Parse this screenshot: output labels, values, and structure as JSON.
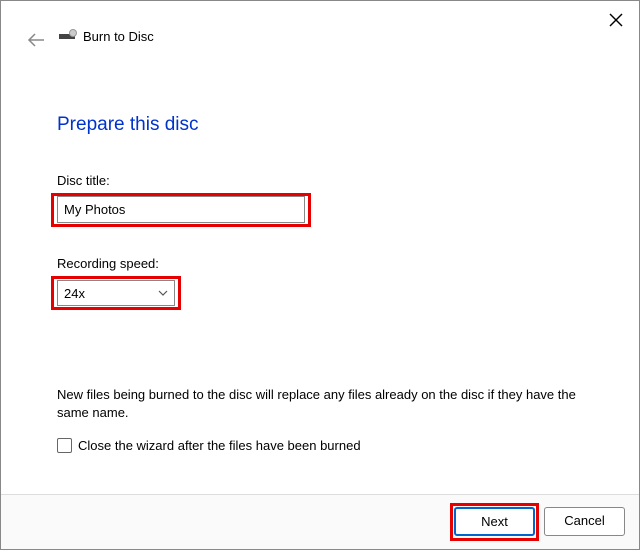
{
  "wizard": {
    "title": "Burn to Disc",
    "heading": "Prepare this disc"
  },
  "fields": {
    "disc_title_label": "Disc title:",
    "disc_title_value": "My Photos",
    "speed_label": "Recording speed:",
    "speed_value": "24x"
  },
  "note": "New files being burned to the disc will replace any files already on the disc if they have the same name.",
  "checkbox": {
    "label": "Close the wizard after the files have been burned",
    "checked": false
  },
  "buttons": {
    "next": "Next",
    "cancel": "Cancel"
  },
  "highlights": {
    "color": "#e60000"
  }
}
